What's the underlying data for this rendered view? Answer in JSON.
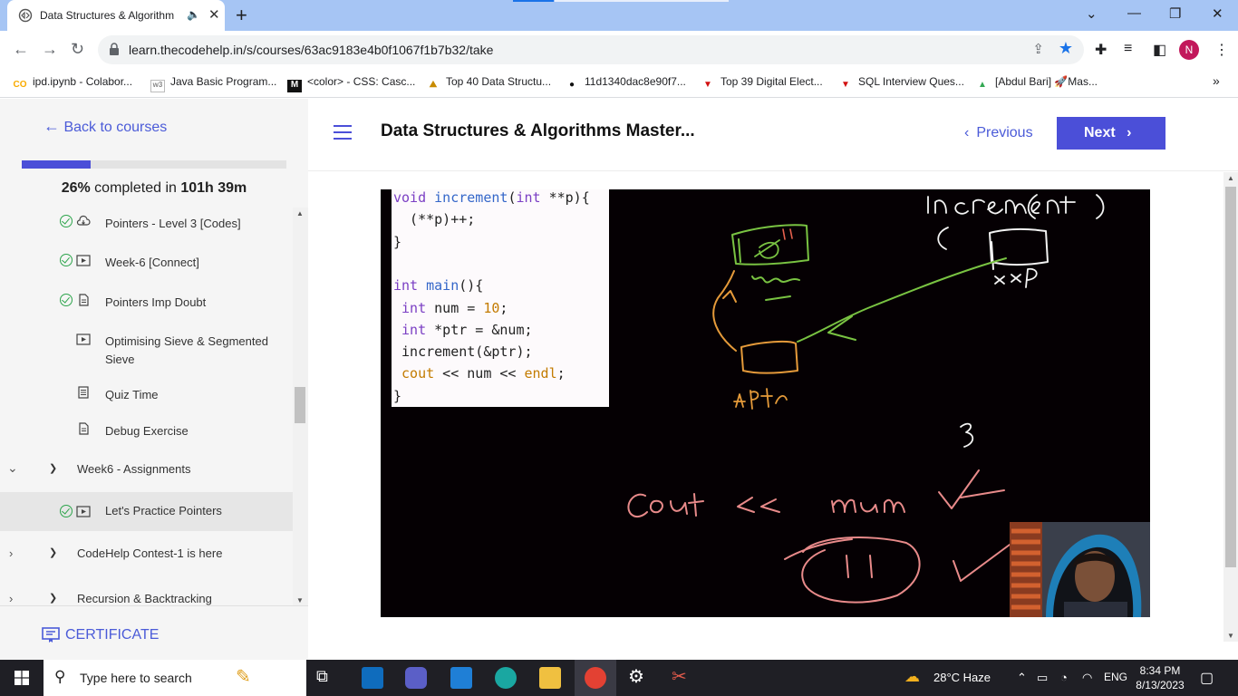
{
  "browser": {
    "tab_title": "Data Structures & Algorithm",
    "url": "learn.thecodehelp.in/s/courses/63ac9183e4b0f1067f1b7b32/take",
    "profile_initial": "N",
    "bookmarks": [
      "ipd.ipynb - Colabor...",
      "Java Basic Program...",
      "<color> - CSS: Casc...",
      "Top 40 Data Structu...",
      "11d1340dac8e90f7...",
      "Top 39 Digital Elect...",
      "SQL Interview Ques...",
      "[Abdul Bari] 🚀Mas..."
    ],
    "bookmark_icon_labels": [
      "CO",
      "w3",
      "M",
      "",
      "",
      "",
      "",
      ""
    ]
  },
  "sidebar": {
    "back_label": "Back to courses",
    "progress_percent": 26,
    "progress_text_pct": "26%",
    "progress_text_mid": " completed in ",
    "progress_text_time": "101h 39m",
    "items": [
      {
        "label": "Pointers - Level 3 [Codes]",
        "done": true,
        "icon": "cloud-download-icon"
      },
      {
        "label": "Week-6 [Connect]",
        "done": true,
        "icon": "video-icon"
      },
      {
        "label": "Pointers Imp Doubt",
        "done": true,
        "icon": "document-icon"
      },
      {
        "label": "Optimising Sieve & Segmented Sieve",
        "done": false,
        "icon": "video-icon"
      },
      {
        "label": "Quiz Time",
        "done": false,
        "icon": "quiz-icon"
      },
      {
        "label": "Debug Exercise",
        "done": false,
        "icon": "document-icon"
      }
    ],
    "section_week6": "Week6 - Assignments",
    "active_item": "Let's Practice Pointers",
    "section_contest": "CodeHelp Contest-1 is here",
    "section_recursion": "Recursion & Backtracking",
    "certificate_label": "CERTIFICATE"
  },
  "header": {
    "course_title": "Data Structures & Algorithms Master...",
    "previous_label": "Previous",
    "next_label": "Next"
  },
  "video": {
    "code_lines": [
      {
        "parts": [
          [
            "kw",
            "void "
          ],
          [
            "fn",
            "increment"
          ],
          [
            "",
            "("
          ],
          [
            "kw",
            "int"
          ],
          [
            "",
            " **p){"
          ]
        ]
      },
      {
        "parts": [
          [
            "",
            "  (**p)++;"
          ]
        ]
      },
      {
        "parts": [
          [
            "",
            "}"
          ]
        ]
      },
      {
        "parts": [
          [
            "",
            ""
          ]
        ]
      },
      {
        "parts": [
          [
            "kw",
            "int "
          ],
          [
            "fn",
            "main"
          ],
          [
            "",
            "(){"
          ]
        ]
      },
      {
        "parts": [
          [
            "",
            " "
          ],
          [
            "kw",
            "int"
          ],
          [
            "",
            " num = "
          ],
          [
            "num",
            "10"
          ],
          [
            "",
            ";"
          ]
        ]
      },
      {
        "parts": [
          [
            "",
            " "
          ],
          [
            "kw",
            "int"
          ],
          [
            "",
            " *ptr = &num;"
          ]
        ]
      },
      {
        "parts": [
          [
            "",
            " increment(&ptr);"
          ]
        ]
      },
      {
        "parts": [
          [
            "",
            " "
          ],
          [
            "num",
            "cout"
          ],
          [
            "",
            " << num << "
          ],
          [
            "num",
            "endl"
          ],
          [
            "",
            ";"
          ]
        ]
      },
      {
        "parts": [
          [
            "",
            "}"
          ]
        ]
      }
    ]
  },
  "taskbar": {
    "search_placeholder": "Type here to search",
    "weather": "28°C  Haze",
    "language": "ENG",
    "time": "8:34 PM",
    "date": "8/13/2023"
  }
}
